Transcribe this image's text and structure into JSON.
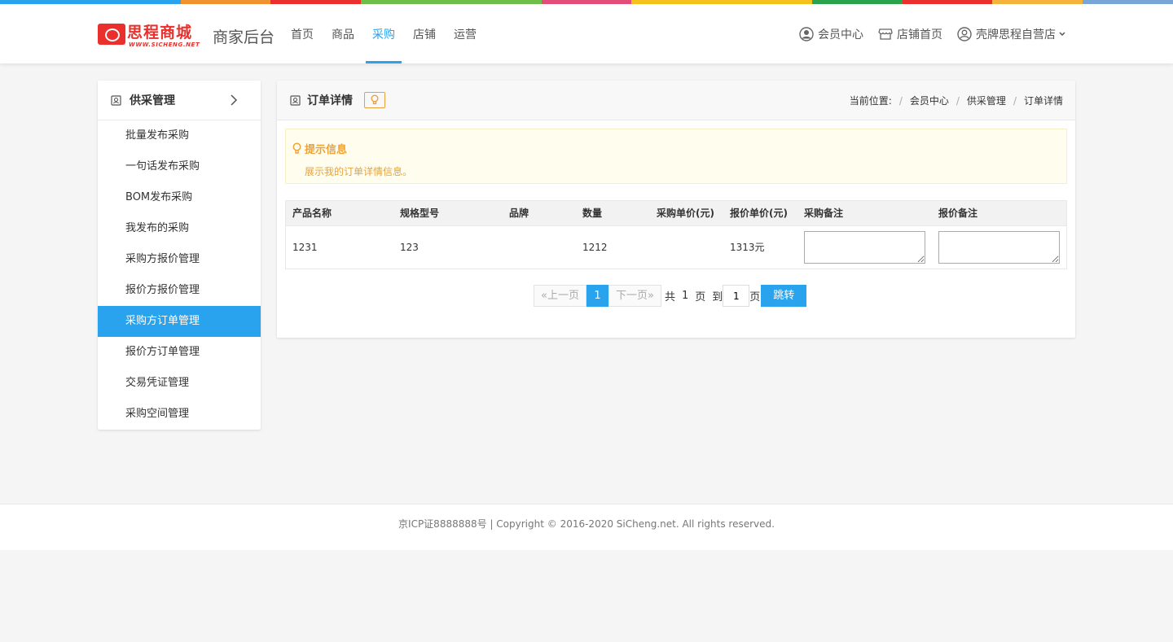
{
  "colors": {
    "accent": "#2aa3ef",
    "brand_red": "#e9302c",
    "tip_orange": "#f0a135",
    "rainbow": [
      "#2aa3ef",
      "#2aa3ef",
      "#f0922d",
      "#e9302c",
      "#6ebe4a",
      "#6ebe4a",
      "#e34d7a",
      "#f5c11c",
      "#f5c11c",
      "#2aa34a",
      "#e9302c",
      "#f5b33c",
      "#7aa5d8"
    ]
  },
  "brand": {
    "logo_text": "思程商城",
    "logo_sub": "WWW.SICHENG.NET",
    "title": "商家后台"
  },
  "nav": [
    {
      "label": "首页"
    },
    {
      "label": "商品"
    },
    {
      "label": "采购",
      "active": true
    },
    {
      "label": "店铺"
    },
    {
      "label": "运营"
    }
  ],
  "topbar": {
    "member_center": "会员中心",
    "shop_home": "店铺首页",
    "store_name": "壳牌思程自营店"
  },
  "sidebar": {
    "title": "供采管理",
    "items": [
      "批量发布采购",
      "一句话发布采购",
      "BOM发布采购",
      "我发布的采购",
      "采购方报价管理",
      "报价方报价管理",
      "采购方订单管理",
      "报价方订单管理",
      "交易凭证管理",
      "采购空间管理"
    ],
    "active_index": 6
  },
  "main": {
    "title": "订单详情",
    "breadcrumb": {
      "prefix": "当前位置:",
      "items": [
        "会员中心",
        "供采管理",
        "订单详情"
      ]
    },
    "tip": {
      "title": "提示信息",
      "text": "展示我的订单详情信息。"
    },
    "table": {
      "headers": [
        "产品名称",
        "规格型号",
        "品牌",
        "数量",
        "采购单价(元)",
        "报价单价(元)",
        "采购备注",
        "报价备注"
      ],
      "rows": [
        [
          "1231",
          "123",
          "",
          "1212",
          "",
          "1313元",
          "",
          ""
        ]
      ]
    },
    "pager": {
      "prev": "«上一页",
      "current": "1",
      "next": "下一页»",
      "total_prefix": "共",
      "total_pages": "1",
      "page_unit": "页",
      "goto_prefix": "到",
      "goto_value": "1",
      "goto_suffix": "页",
      "goto_button": "跳转"
    }
  },
  "footer": {
    "text": "京ICP证8888888号 | Copyright © 2016-2020 SiCheng.net. All rights reserved."
  }
}
